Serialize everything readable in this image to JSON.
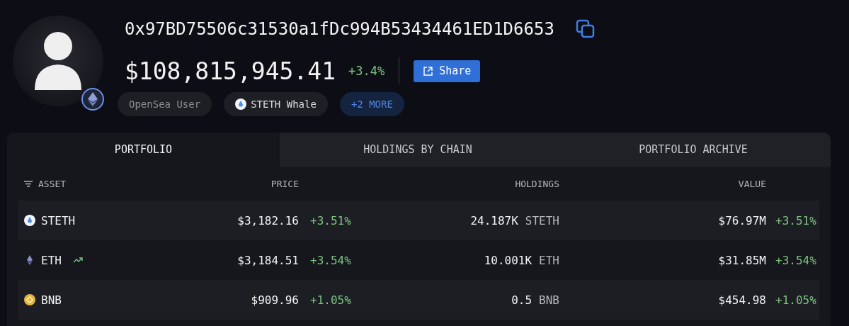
{
  "profile": {
    "address": "0x97BD75506c31530a1fDc994B53434461ED1D6653",
    "total_value": "$108,815,945.41",
    "change": "+3.4%",
    "share_button": "Share",
    "badges": [
      {
        "label": "OpenSea User",
        "kind": "plain"
      },
      {
        "label": "STETH Whale",
        "kind": "token"
      },
      {
        "label": "+2 MORE",
        "kind": "more"
      }
    ]
  },
  "tabs": [
    {
      "label": "PORTFOLIO",
      "selected": true
    },
    {
      "label": "HOLDINGS BY CHAIN",
      "selected": false
    },
    {
      "label": "PORTFOLIO ARCHIVE",
      "selected": false
    }
  ],
  "table": {
    "columns": [
      "ASSET",
      "PRICE",
      "HOLDINGS",
      "VALUE"
    ],
    "rows": [
      {
        "kind": "steth",
        "asset": "STETH",
        "trending": false,
        "price": "$3,182.16",
        "price_change": "+3.51%",
        "amount": "24.187K",
        "unit": "STETH",
        "value": "$76.97M",
        "value_change": "+3.51%"
      },
      {
        "kind": "eth",
        "asset": "ETH",
        "trending": true,
        "price": "$3,184.51",
        "price_change": "+3.54%",
        "amount": "10.001K",
        "unit": "ETH",
        "value": "$31.85M",
        "value_change": "+3.54%"
      },
      {
        "kind": "bnb",
        "asset": "BNB",
        "trending": false,
        "price": "$909.96",
        "price_change": "+1.05%",
        "amount": "0.5",
        "unit": "BNB",
        "value": "$454.98",
        "value_change": "+1.05%"
      }
    ]
  }
}
